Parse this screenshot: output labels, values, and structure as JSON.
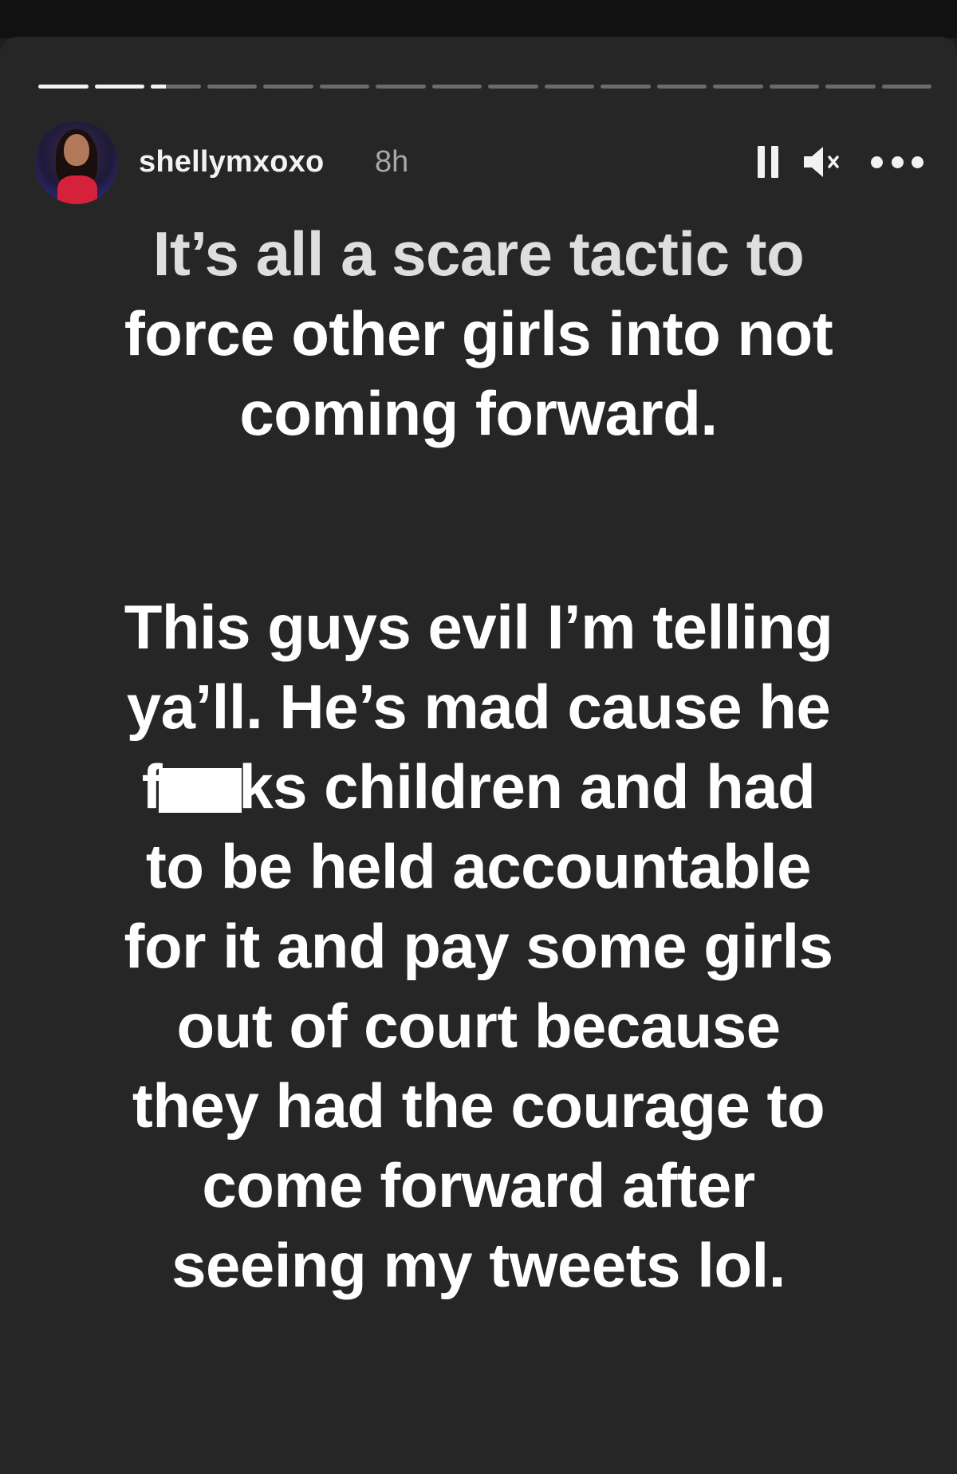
{
  "story": {
    "progress": {
      "segments": 16,
      "completed": 2,
      "current_fraction": 0.3
    },
    "header": {
      "username": "shellymxoxo",
      "time": "8h",
      "avatar_icon": "profile-avatar",
      "controls": [
        "pause-icon",
        "mute-icon",
        "more-icon"
      ]
    },
    "paragraph1": [
      "It’s all a scare tactic to",
      "force other girls into not",
      "coming forward."
    ],
    "paragraph2": {
      "line1": "This guys evil I’m telling",
      "line2": "ya’ll. He’s mad cause he",
      "line3_prefix": "f",
      "line3_suffix": "ks children and had",
      "line4": "to be held accountable",
      "line5": "for it and pay some girls",
      "line6": "out of court because",
      "line7": "they had the courage to",
      "line8": "come forward after",
      "line9": "seeing my tweets lol."
    },
    "colors": {
      "background": "#262626",
      "text": "#ffffff",
      "timestamp": "#a8a8a8"
    }
  }
}
